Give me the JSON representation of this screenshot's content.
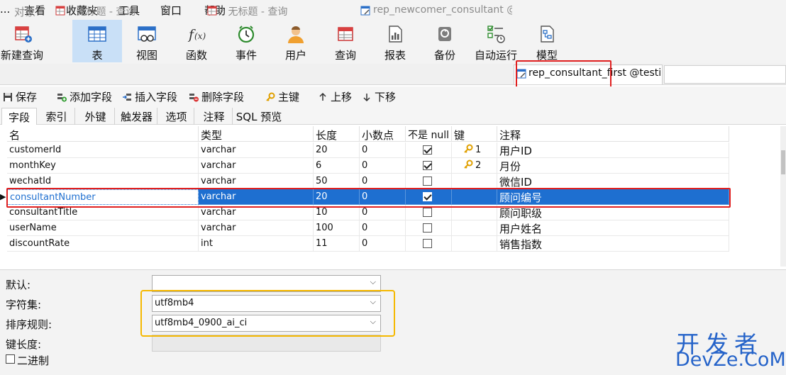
{
  "menu": [
    "...",
    "查看",
    "收藏夹",
    "工具",
    "窗口",
    "帮助"
  ],
  "toolbar": [
    {
      "label": "新建查询",
      "icon": "new-query-icon"
    },
    {
      "label": "表",
      "icon": "table-icon"
    },
    {
      "label": "视图",
      "icon": "view-icon"
    },
    {
      "label": "函数",
      "icon": "function-icon"
    },
    {
      "label": "事件",
      "icon": "event-icon"
    },
    {
      "label": "用户",
      "icon": "user-icon"
    },
    {
      "label": "查询",
      "icon": "query-icon"
    },
    {
      "label": "报表",
      "icon": "report-icon"
    },
    {
      "label": "备份",
      "icon": "backup-icon"
    },
    {
      "label": "自动运行",
      "icon": "automation-icon"
    },
    {
      "label": "模型",
      "icon": "model-icon"
    }
  ],
  "tabs": [
    {
      "label": "对象"
    },
    {
      "label": "* 无标题 - 查询"
    },
    {
      "label": "* 无标题 - 查询"
    },
    {
      "label": "rep_newcomer_consultant @te..."
    },
    {
      "label": "rep_consultant_first @testing_..."
    }
  ],
  "actions": [
    {
      "label": "保存",
      "icon": "save-icon"
    },
    {
      "label": "添加字段",
      "icon": "add-field-icon"
    },
    {
      "label": "插入字段",
      "icon": "insert-field-icon"
    },
    {
      "label": "删除字段",
      "icon": "delete-field-icon"
    },
    {
      "label": "主键",
      "icon": "primary-key-icon"
    },
    {
      "label": "上移",
      "icon": "arrow-up-icon"
    },
    {
      "label": "下移",
      "icon": "arrow-down-icon"
    }
  ],
  "subtabs": [
    "字段",
    "索引",
    "外键",
    "触发器",
    "选项",
    "注释",
    "SQL 预览"
  ],
  "columns": [
    "名",
    "类型",
    "长度",
    "小数点",
    "不是 null",
    "键",
    "注释"
  ],
  "rows": [
    {
      "name": "customerId",
      "type": "varchar",
      "length": "20",
      "decimals": "0",
      "not_null": true,
      "key": "1",
      "comment": "用户ID"
    },
    {
      "name": "monthKey",
      "type": "varchar",
      "length": "6",
      "decimals": "0",
      "not_null": true,
      "key": "2",
      "comment": "月份"
    },
    {
      "name": "wechatId",
      "type": "varchar",
      "length": "50",
      "decimals": "0",
      "not_null": false,
      "key": "",
      "comment": "微信ID"
    },
    {
      "name": "consultantNumber",
      "type": "varchar",
      "length": "20",
      "decimals": "0",
      "not_null": true,
      "key": "",
      "comment": "顾问编号",
      "selected": true
    },
    {
      "name": "consultantTitle",
      "type": "varchar",
      "length": "10",
      "decimals": "0",
      "not_null": false,
      "key": "",
      "comment": "顾问职级"
    },
    {
      "name": "userName",
      "type": "varchar",
      "length": "100",
      "decimals": "0",
      "not_null": false,
      "key": "",
      "comment": "用户姓名"
    },
    {
      "name": "discountRate",
      "type": "int",
      "length": "11",
      "decimals": "0",
      "not_null": false,
      "key": "",
      "comment": "销售指数"
    }
  ],
  "props": {
    "default_label": "默认:",
    "default_value": "",
    "charset_label": "字符集:",
    "charset_value": "utf8mb4",
    "collation_label": "排序规则:",
    "collation_value": "utf8mb4_0900_ai_ci",
    "keylen_label": "键长度:",
    "binary_label": "二进制"
  },
  "watermark": {
    "line1": "开发者",
    "line2": "DevZe.CoM"
  }
}
